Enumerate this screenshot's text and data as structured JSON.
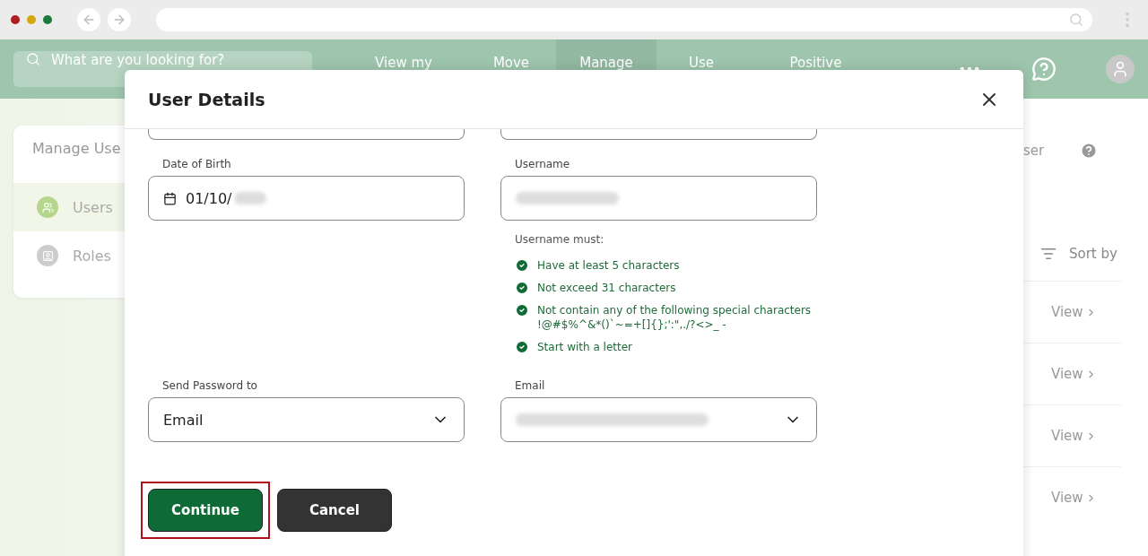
{
  "header": {
    "search": {
      "placeholder": "What are you looking for?"
    },
    "nav": [
      {
        "label": "View my",
        "selected": false
      },
      {
        "label": "Move",
        "selected": false
      },
      {
        "label": "Manage",
        "selected": true
      },
      {
        "label": "Use",
        "selected": false
      },
      {
        "label": "Positive",
        "selected": false
      }
    ]
  },
  "sidebar": {
    "title": "Manage Use",
    "items": [
      {
        "label": "Users",
        "selected": true,
        "kind": "users"
      },
      {
        "label": "Roles",
        "selected": false,
        "kind": "roles"
      }
    ]
  },
  "main": {
    "action": "ser",
    "sort": "Sort by",
    "rows": [
      {
        "link": "View"
      },
      {
        "link": "View"
      },
      {
        "link": "View"
      },
      {
        "link": "View"
      }
    ]
  },
  "modal": {
    "title": "User Details",
    "date_of_birth": {
      "label": "Date of Birth",
      "value": "01/10/"
    },
    "username": {
      "label": "Username"
    },
    "rules_title": "Username must:",
    "rules": [
      {
        "text": "Have at least 5 characters",
        "checked": true
      },
      {
        "text": "Not exceed 31 characters",
        "checked": true
      },
      {
        "text": "Not contain any of the following special characters\n!@#$%^&*()`~=+[]{};':\",./?<>_ -",
        "checked": true
      },
      {
        "text": "Start with a letter",
        "checked": true
      }
    ],
    "send_password_to": {
      "label": "Send Password to",
      "value": "Email"
    },
    "email": {
      "label": "Email"
    },
    "buttons": [
      {
        "label": "Continue",
        "kind": "primary",
        "highlighted": true
      },
      {
        "label": "Cancel",
        "kind": "secondary",
        "highlighted": false
      }
    ]
  }
}
